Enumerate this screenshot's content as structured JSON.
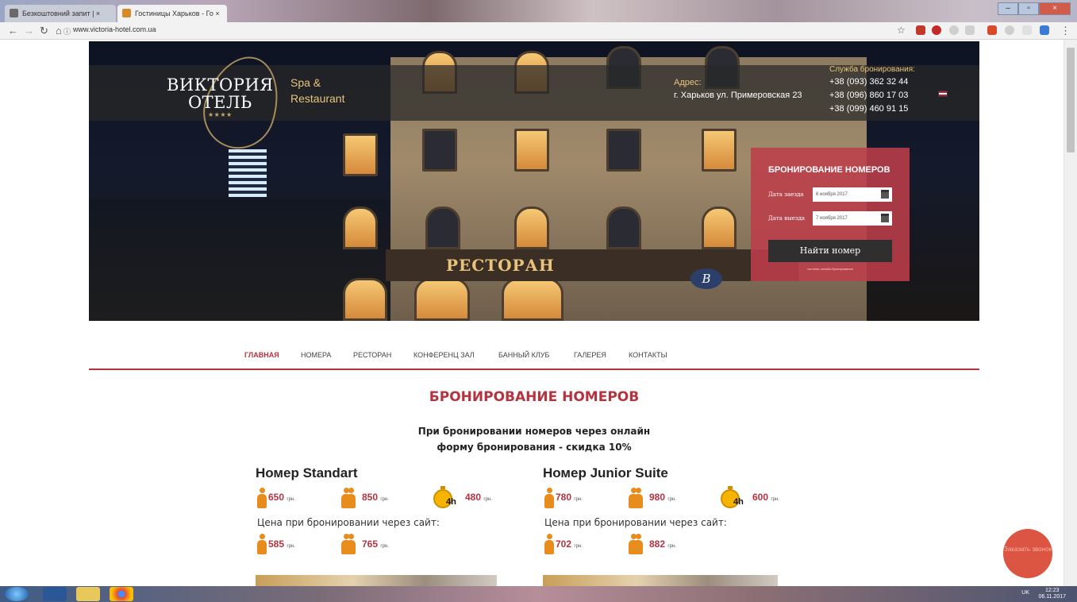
{
  "browser": {
    "tabs": [
      {
        "label": "Безкоштовний запит | ×",
        "active": false
      },
      {
        "label": "Гостиницы Харьков - Го ×",
        "active": true
      }
    ],
    "url": "www.victoria-hotel.com.ua"
  },
  "header": {
    "logo_line1": "ВИКТОРИЯ",
    "logo_line2": "ОТЕЛЬ",
    "logo_stars": "★★★★",
    "spa_line1": "Spa &",
    "spa_line2": "Restaurant",
    "address_label": "Адрес:",
    "address": "г. Харьков ул. Примеровская 23",
    "booking_label": "Служба бронирования:",
    "phones": [
      "+38 (093) 362 32 44",
      "+38 (096) 860 17 03",
      "+38 (099) 460 91 15"
    ]
  },
  "hero": {
    "restaurant_sign": "РЕСТОРАН",
    "emblem": "B"
  },
  "booking_form": {
    "title": "БРОНИРОВАНИЕ НОМЕРОВ",
    "checkin_label": "Дата заезда",
    "checkin_value": "6 ноября 2017",
    "checkout_label": "Дата выезда",
    "checkout_value": "7 ноября 2017",
    "submit": "Найти номер",
    "note": "система онлайн-бронирования"
  },
  "nav": [
    {
      "label": "ГЛАВНАЯ",
      "active": true
    },
    {
      "label": "НОМЕРА",
      "active": false
    },
    {
      "label": "РЕСТОРАН",
      "active": false
    },
    {
      "label": "КОНФЕРЕНЦ ЗАЛ",
      "active": false
    },
    {
      "label": "БАННЫЙ КЛУБ",
      "active": false
    },
    {
      "label": "ГАЛЕРЕЯ",
      "active": false
    },
    {
      "label": "КОНТАКТЫ",
      "active": false
    }
  ],
  "main": {
    "title": "БРОНИРОВАНИЕ НОМЕРОВ",
    "promo_line1": "При бронировании номеров через онлайн",
    "promo_line2": "форму бронирования - скидка 10%",
    "currency": "грн.",
    "site_price_label": "Цена при бронировании через сайт:",
    "hours_badge": "4h",
    "rooms": [
      {
        "name": "Номер Standart",
        "single": "650",
        "double": "850",
        "hourly": "480",
        "site_single": "585",
        "site_double": "765"
      },
      {
        "name": "Номер Junior Suite",
        "single": "780",
        "double": "980",
        "hourly": "600",
        "site_single": "702",
        "site_double": "882"
      }
    ]
  },
  "callback_button": "Заказать звонок",
  "taskbar": {
    "lang": "UK",
    "time": "12:23",
    "date": "06.11.2017"
  },
  "colors": {
    "accent": "#b5333e",
    "booking_box": "#bc3e4a",
    "gold": "#e8c47a",
    "icon_orange": "#e88d1d"
  }
}
